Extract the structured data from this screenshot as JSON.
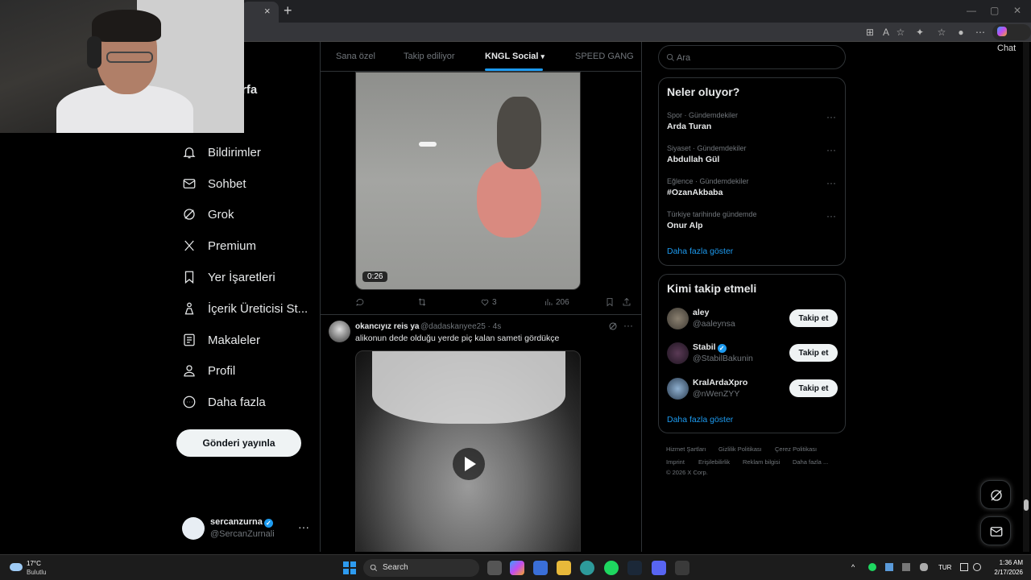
{
  "browser": {
    "new_tab": "+",
    "close_tab": "×",
    "chat_label": "Chat"
  },
  "sidebar": {
    "name_fragment": "rfa",
    "items": [
      {
        "label": "Bildirimler",
        "icon": "bell-icon"
      },
      {
        "label": "Sohbet",
        "icon": "envelope-icon"
      },
      {
        "label": "Grok",
        "icon": "grok-icon"
      },
      {
        "label": "Premium",
        "icon": "x-logo-icon"
      },
      {
        "label": "Yer İşaretleri",
        "icon": "bookmark-icon"
      },
      {
        "label": "İçerik Üreticisi St...",
        "icon": "creator-studio-icon"
      },
      {
        "label": "Makaleler",
        "icon": "article-icon"
      },
      {
        "label": "Profil",
        "icon": "person-icon"
      },
      {
        "label": "Daha fazla",
        "icon": "more-circle-icon"
      }
    ],
    "post_button": "Gönderi yayınla",
    "account": {
      "name": "sercanzurna",
      "handle": "@SercanZurnali",
      "more": "···"
    }
  },
  "feed": {
    "tabs": [
      "Sana özel",
      "Takip ediliyor",
      "KNGL Social",
      "SPEED GANG"
    ],
    "active_tab": "KNGL Social",
    "post1": {
      "duration": "0:26",
      "likes": "3",
      "views": "206"
    },
    "post2": {
      "author": "okancıyız reis ya",
      "handle_time": "@dadaskanyee25 · 4s",
      "text": "alikonun dede olduğu yerde piç kalan sameti gördükçe",
      "more": "···"
    }
  },
  "search": {
    "placeholder": "Ara"
  },
  "trends": {
    "title": "Neler oluyor?",
    "items": [
      {
        "category": "Spor · Gündemdekiler",
        "name": "Arda Turan"
      },
      {
        "category": "Siyaset · Gündemdekiler",
        "name": "Abdullah Gül"
      },
      {
        "category": "Eğlence · Gündemdekiler",
        "name": "#OzanAkbaba"
      },
      {
        "category": "Türkiye tarihinde gündemde",
        "name": "Onur Alp"
      }
    ],
    "more_dots": "···",
    "show_more": "Daha fazla göster"
  },
  "who_to_follow": {
    "title": "Kimi takip etmeli",
    "users": [
      {
        "name": "aley",
        "handle": "@aaleynsa",
        "verified": false
      },
      {
        "name": "Stabil",
        "handle": "@StabilBakunin",
        "verified": true
      },
      {
        "name": "KralArdaXpro",
        "handle": "@nWenZYY",
        "verified": false
      }
    ],
    "follow_label": "Takip et",
    "show_more": "Daha fazla göster"
  },
  "footer": {
    "links": [
      "Hizmet Şartları",
      "Gizlilik Politikası",
      "Çerez Politikası",
      "Imprint",
      "Erişilebilirlik",
      "Reklam bilgisi",
      "Daha fazla ..."
    ],
    "copyright": "© 2026 X Corp."
  },
  "taskbar": {
    "weather_temp": "17°C",
    "weather_condition": "Bulutlu",
    "search_label": "Search",
    "language": "TUR",
    "time": "1:36 AM",
    "date": "2/17/2026"
  },
  "colors": {
    "accent": "#1d9bf0",
    "background": "#000000",
    "border": "#2f3336",
    "muted_text": "#71767b"
  }
}
